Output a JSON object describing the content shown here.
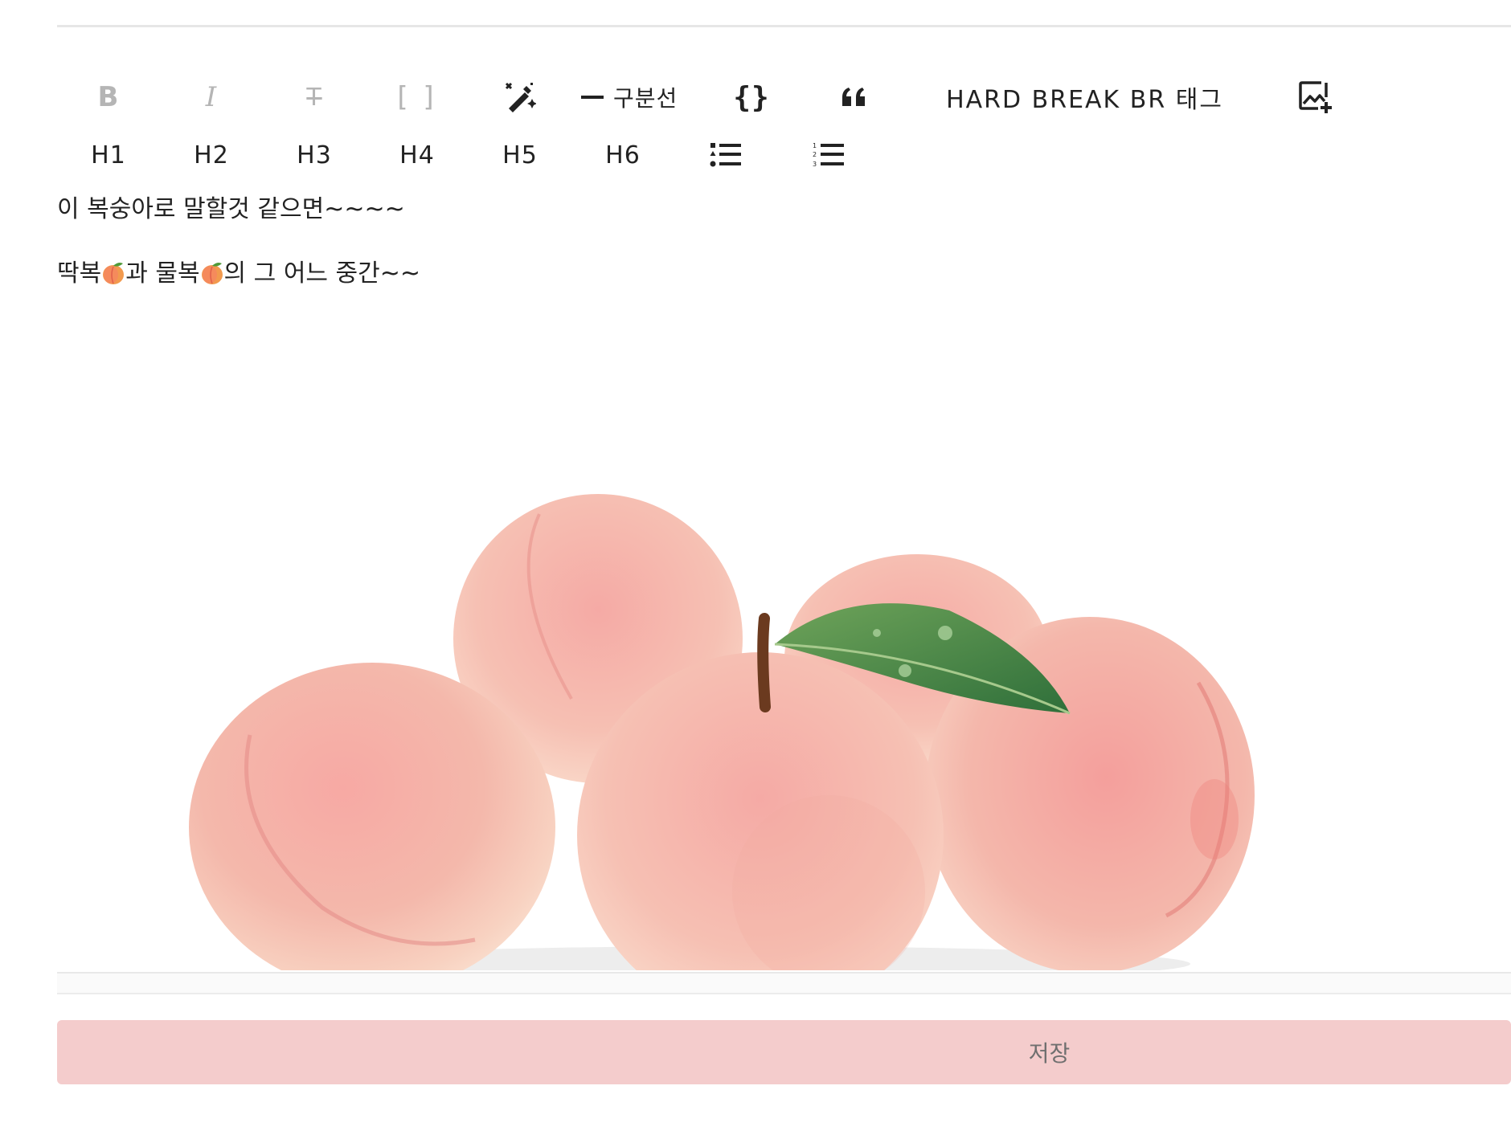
{
  "toolbar": {
    "row1": [
      {
        "name": "bold-button",
        "label": "B"
      },
      {
        "name": "italic-button",
        "label": "I"
      },
      {
        "name": "strike-button",
        "label": "T"
      },
      {
        "name": "brackets-button",
        "label": "[ ]"
      },
      {
        "name": "magic-wand-button",
        "icon": "magic-wand-icon"
      },
      {
        "name": "divider-button",
        "label": "구분선"
      },
      {
        "name": "code-block-button",
        "label": "{}"
      },
      {
        "name": "blockquote-button",
        "label": "❝"
      },
      {
        "name": "hard-break-button",
        "label": "HARD BREAK BR 태그"
      },
      {
        "name": "add-image-button",
        "icon": "add-image-icon"
      }
    ],
    "row2": [
      {
        "name": "heading-1-button",
        "label": "H1"
      },
      {
        "name": "heading-2-button",
        "label": "H2"
      },
      {
        "name": "heading-3-button",
        "label": "H3"
      },
      {
        "name": "heading-4-button",
        "label": "H4"
      },
      {
        "name": "heading-5-button",
        "label": "H5"
      },
      {
        "name": "heading-6-button",
        "label": "H6"
      },
      {
        "name": "bullet-list-button",
        "icon": "bullet-list-icon"
      },
      {
        "name": "ordered-list-button",
        "icon": "ordered-list-icon"
      }
    ]
  },
  "editor": {
    "line1": "이 복숭아로 말할것 같으면~~~~",
    "line2": {
      "part1": "딱복",
      "part2": "과 물복",
      "part3": "의 그 어느 중간~~"
    },
    "image_icon": "peaches-photo"
  },
  "save_label": "저장",
  "colors": {
    "save_button_bg": "#f4cccc",
    "muted_icon": "#b5b5b5",
    "text": "#222222"
  }
}
